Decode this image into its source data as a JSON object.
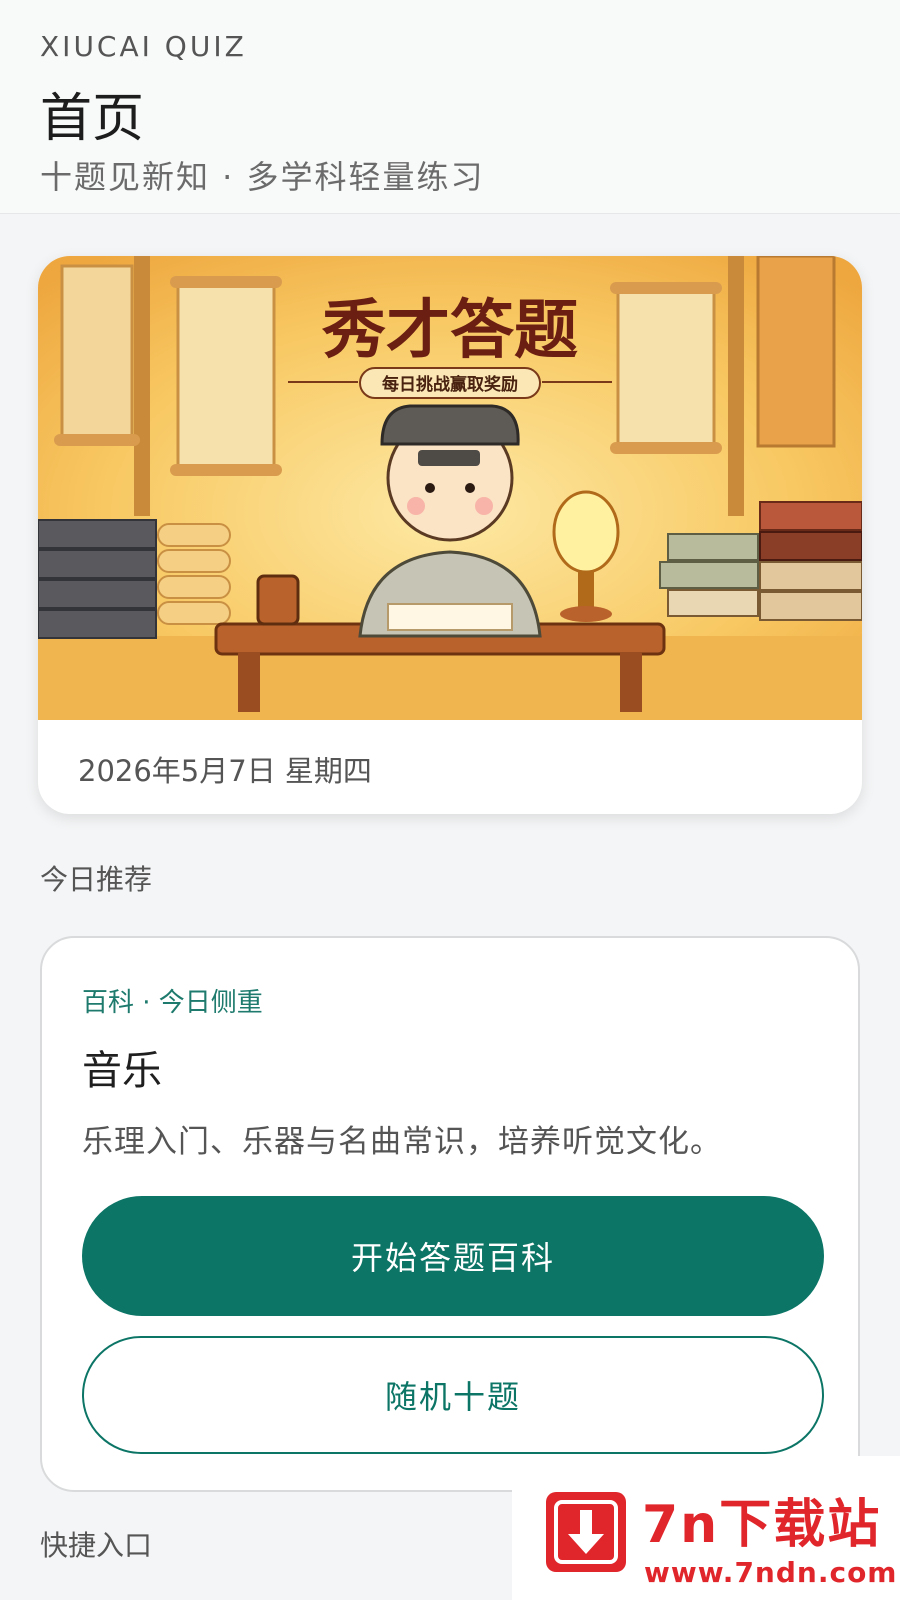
{
  "header": {
    "eyebrow": "XIUCAI QUIZ",
    "title": "首页",
    "subtitle": "十题见新知 · 多学科轻量练习"
  },
  "hero": {
    "banner_title": "秀才答题",
    "banner_tagline": "每日挑战赢取奖励",
    "date": "2026年5月7日 星期四"
  },
  "today": {
    "section_label": "今日推荐",
    "tag": "百科 · 今日侧重",
    "title": "音乐",
    "description": "乐理入门、乐器与名曲常识，培养听觉文化。",
    "primary_button": "开始答题百科",
    "secondary_button": "随机十题"
  },
  "shortcuts": {
    "section_label": "快捷入口"
  },
  "watermark": {
    "name": "7n下载站",
    "url": "www.7ndn.com",
    "icon": "download-arrow-icon"
  },
  "colors": {
    "accent": "#0c7566",
    "banner_bg": "#f6c15a",
    "watermark": "#e0262b"
  }
}
